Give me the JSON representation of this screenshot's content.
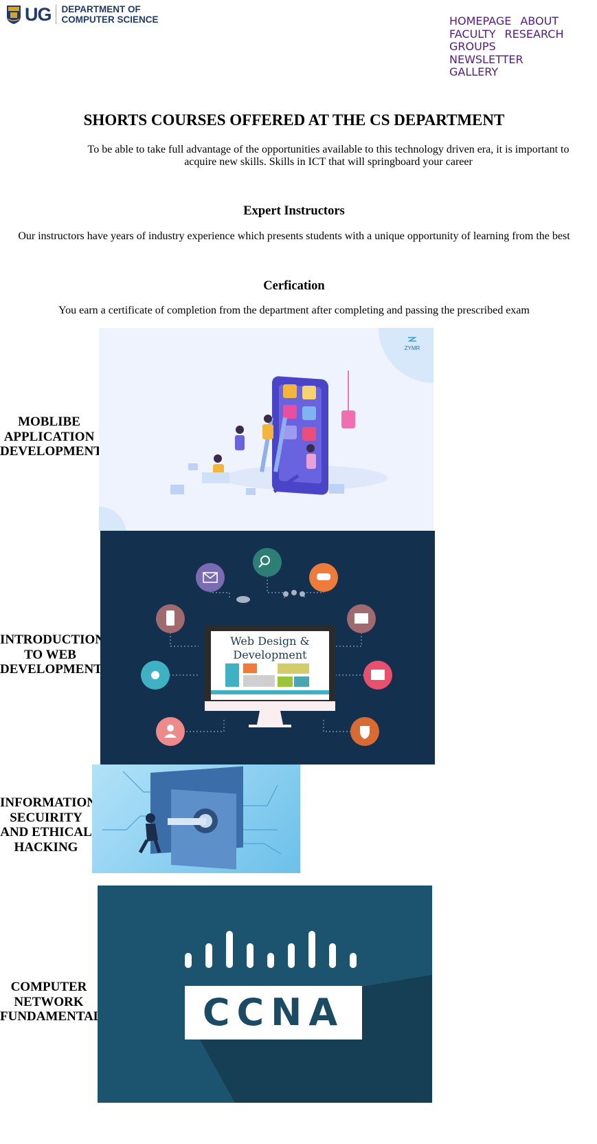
{
  "header": {
    "logo_mark": "UG",
    "logo_line1": "DEPARTMENT OF",
    "logo_line2": "COMPUTER SCIENCE"
  },
  "nav": {
    "items": [
      "HOMEPAGE",
      "ABOUT",
      "FACULTY",
      "RESEARCH",
      "GROUPS",
      "NEWSLETTER",
      "GALLERY"
    ]
  },
  "main": {
    "title": "SHORTS COURSES OFFERED AT THE CS DEPARTMENT",
    "intro": "To be able to take full advantage of the opportunities available to this technology driven era, it is important to acquire new skills. Skills in ICT that will springboard your career",
    "sections": [
      {
        "heading": "Expert Instructors",
        "text": "Our instructors have years of industry experience which presents students with a unique opportunity of learning from the best"
      },
      {
        "heading": "Cerfication",
        "text": "You earn a certificate of completion from the department after completing and passing the prescribed exam"
      }
    ]
  },
  "courses": [
    {
      "label": "MOBLIBE APPLICATION DEVELOPMENT",
      "image_brand": "ZYMR"
    },
    {
      "label": "INTRODUCTION TO WEB DEVELOPMENT",
      "image_text_1": "Web Design &",
      "image_text_2": "Development"
    },
    {
      "label": "INFORMATION SECUIRITY AND ETHICAL HACKING"
    },
    {
      "label": "COMPUTER NETWORK FUNDAMENTAL",
      "image_text": "CCNA"
    }
  ],
  "colors": {
    "link": "#551a8b",
    "logo_blue": "#1f3a6e",
    "web_bg": "#13304f",
    "ccna_bg": "#1c5470",
    "mobile_bg": "#eef3fd",
    "security_bg": "#8fd0f0"
  }
}
